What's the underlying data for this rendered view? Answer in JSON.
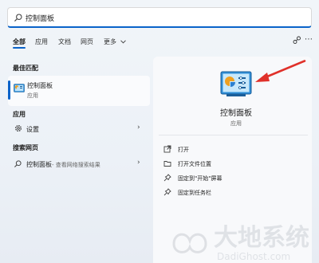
{
  "search": {
    "value": "控制面板"
  },
  "tabs": [
    {
      "label": "全部"
    },
    {
      "label": "应用"
    },
    {
      "label": "文档"
    },
    {
      "label": "网页"
    },
    {
      "label": "更多"
    }
  ],
  "left": {
    "best_match_title": "最佳匹配",
    "best_match": {
      "title": "控制面板",
      "subtitle": "应用"
    },
    "apps_title": "应用",
    "apps": [
      {
        "label": "设置"
      }
    ],
    "web_title": "搜索网页",
    "web": [
      {
        "label": "控制面板",
        "hint": " - 查看网络搜索结果"
      }
    ]
  },
  "panel": {
    "title": "控制面板",
    "subtitle": "应用",
    "actions": [
      {
        "label": "打开",
        "icon": "open-icon"
      },
      {
        "label": "打开文件位置",
        "icon": "folder-icon"
      },
      {
        "label": "固定到\"开始\"屏幕",
        "icon": "pin-icon"
      },
      {
        "label": "固定到任务栏",
        "icon": "pin-icon"
      }
    ]
  },
  "watermark": {
    "text": "大地系统",
    "subtext": "DadiGhost.com"
  },
  "colors": {
    "accent": "#0a63c9",
    "arrow": "#e0312a"
  }
}
